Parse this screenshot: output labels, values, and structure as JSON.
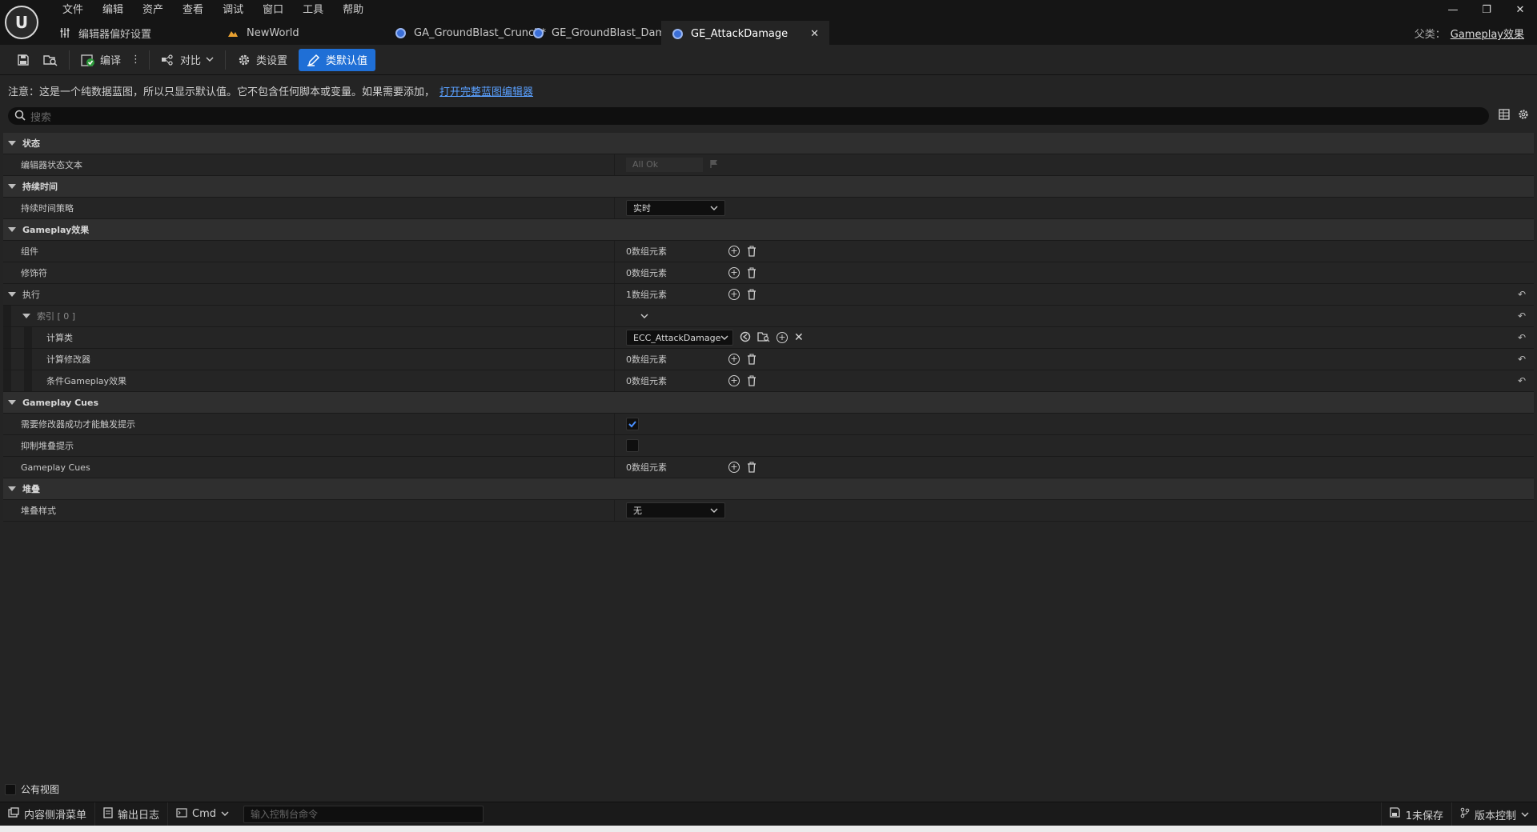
{
  "menu": [
    "文件",
    "编辑",
    "资产",
    "查看",
    "调试",
    "窗口",
    "工具",
    "帮助"
  ],
  "tabs": [
    {
      "label": "编辑器偏好设置",
      "icon": "sliders-icon"
    },
    {
      "label": "NewWorld",
      "icon": "level-icon"
    },
    {
      "label": "GA_GroundBlast_Crunch*",
      "icon": "blueprint-icon"
    },
    {
      "label": "GE_GroundBlast_Damage",
      "icon": "blueprint-icon"
    },
    {
      "label": "GE_AttackDamage",
      "icon": "blueprint-icon",
      "active": true
    }
  ],
  "parent": {
    "label": "父类：",
    "value": "Gameplay效果"
  },
  "toolbar": {
    "compile": "编译",
    "diff": "对比",
    "class_settings": "类设置",
    "class_defaults": "类默认值"
  },
  "notice": {
    "text": "注意：这是一个纯数据蓝图，所以只显示默认值。它不包含任何脚本或变量。如果需要添加，",
    "link": "打开完整蓝图编辑器"
  },
  "search": {
    "placeholder": "搜索"
  },
  "details": {
    "status_cat": "状态",
    "status_text_label": "编辑器状态文本",
    "status_text_value": "All Ok",
    "duration_cat": "持续时间",
    "duration_policy_label": "持续时间策略",
    "duration_policy_value": "实时",
    "gameplay_cat": "Gameplay效果",
    "components_label": "组件",
    "components_value": "0数组元素",
    "modifiers_label": "修饰符",
    "modifiers_value": "0数组元素",
    "executions_label": "执行",
    "executions_value": "1数组元素",
    "index_label": "索引 [ 0 ]",
    "calc_class_label": "计算类",
    "calc_class_value": "ECC_AttackDamage",
    "calc_mod_label": "计算修改器",
    "calc_mod_value": "0数组元素",
    "cond_label": "条件Gameplay效果",
    "cond_value": "0数组元素",
    "cues_cat": "Gameplay Cues",
    "require_success_label": "需要修改器成功才能触发提示",
    "require_success_checked": true,
    "suppress_label": "抑制堆叠提示",
    "suppress_checked": false,
    "cues_label": "Gameplay Cues",
    "cues_value": "0数组元素",
    "stack_cat": "堆叠",
    "stack_type_label": "堆叠样式",
    "stack_type_value": "无"
  },
  "public_view": "公有视图",
  "status": {
    "content_drawer": "内容侧滑菜单",
    "output_log": "输出日志",
    "cmd": "Cmd",
    "console_placeholder": "输入控制台命令",
    "unsaved": "1未保存",
    "source_control": "版本控制"
  },
  "colors": {
    "accent": "#1f6fd6",
    "link": "#5aa0ff",
    "background": "#242424"
  }
}
